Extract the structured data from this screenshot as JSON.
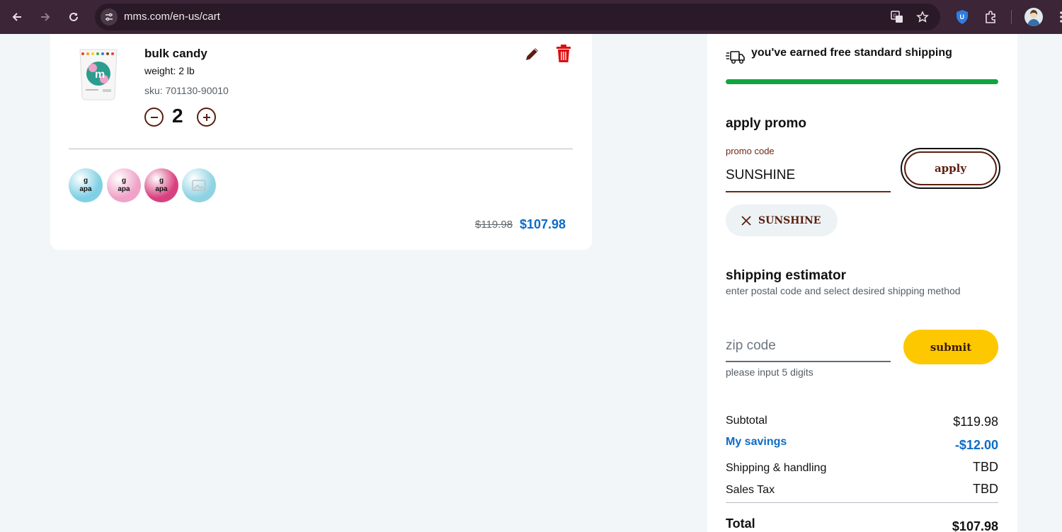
{
  "browser": {
    "url": "mms.com/en-us/cart"
  },
  "cart": {
    "product_name": "bulk candy",
    "weight": "weight: 2 lb",
    "sku": "sku: 701130-90010",
    "quantity": "2",
    "swatch_text": [
      "g\napa",
      "g\napa",
      "g\napa",
      ""
    ],
    "swatch_colors": [
      "#7fd0e4",
      "#f0a2c8",
      "#d8417f",
      "#8fd3e3"
    ],
    "old_price": "$119.98",
    "new_price": "$107.98"
  },
  "summary": {
    "shipping_message": "you've earned free standard shipping",
    "shipping_progress_percent": 100,
    "promo_title": "apply promo",
    "promo_label": "promo code",
    "promo_value": "SUNSHINE",
    "apply_label": "apply",
    "applied_code": "SUNSHINE",
    "estimator_title": "shipping estimator",
    "estimator_sub": "enter postal code and select desired shipping method",
    "zip_placeholder": "zip code",
    "zip_hint": "please input 5 digits",
    "submit_label": "submit",
    "rows": [
      {
        "label": "Subtotal",
        "value": "$119.98"
      },
      {
        "label": "My savings",
        "value": "-$12.00"
      },
      {
        "label": "Shipping & handling",
        "value": "TBD"
      },
      {
        "label": "Sales Tax",
        "value": "TBD"
      }
    ],
    "total_label": "Total",
    "total_value": "$107.98"
  },
  "colors": {
    "brand_brown": "#5a1f0f",
    "savings_blue": "#0d6bc6",
    "progress_green": "#10a540",
    "submit_yellow": "#fdc800"
  }
}
